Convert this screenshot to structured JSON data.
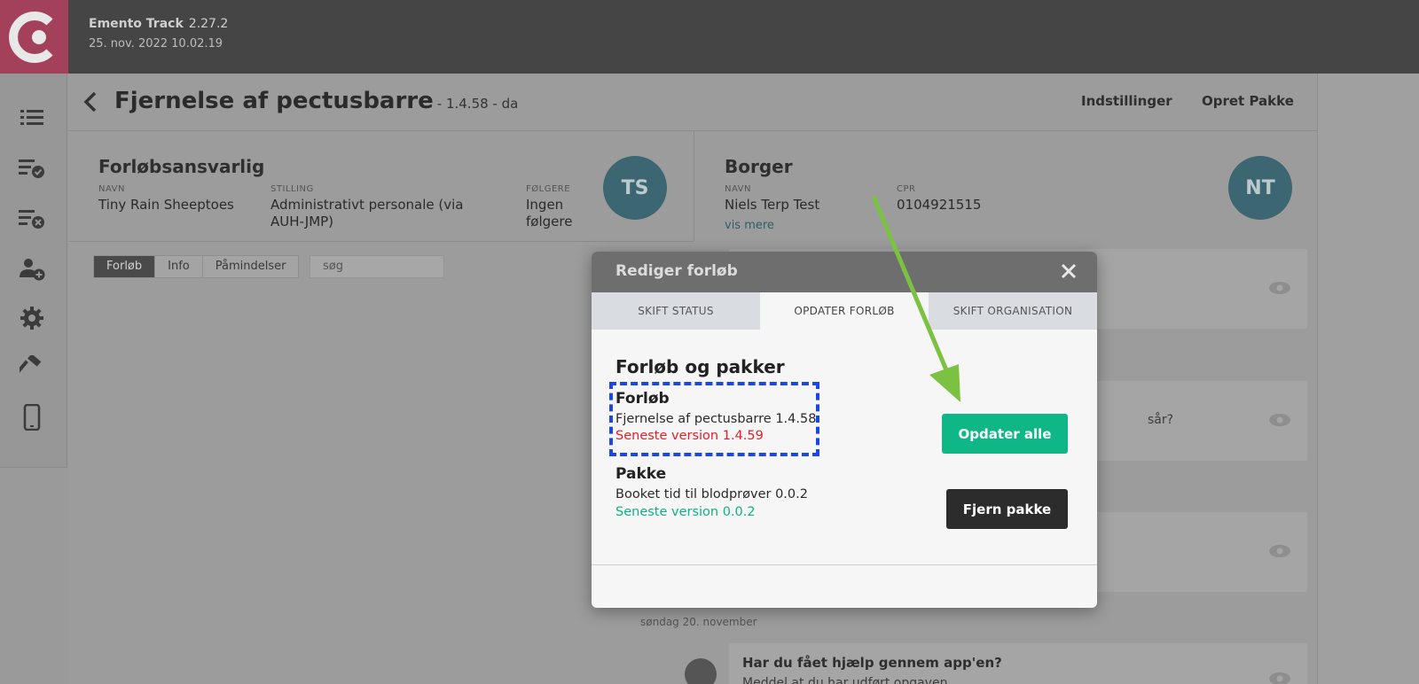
{
  "app": {
    "name": "Emento Track",
    "version": "2.27.2",
    "datetime": "25. nov. 2022 10.02.19"
  },
  "sidebar": {
    "items": [
      {
        "icon": "list-icon"
      },
      {
        "icon": "list-check-icon"
      },
      {
        "icon": "list-remove-icon"
      },
      {
        "icon": "add-user-icon"
      },
      {
        "icon": "gear-icon"
      },
      {
        "icon": "hammer-icon"
      },
      {
        "icon": "phone-icon"
      }
    ]
  },
  "header": {
    "title": "Fjernelse af pectusbarre",
    "subtitle": "- 1.4.58 - da",
    "links": [
      "Indstillinger",
      "Opret Pakke"
    ]
  },
  "responsible": {
    "title": "Forløbsansvarlig",
    "name_label": "NAVN",
    "name": "Tiny Rain Sheeptoes",
    "position_label": "STILLING",
    "position": "Administrativt personale (via AUH-JMP)",
    "followers_label": "FØLGERE",
    "followers": "Ingen følgere",
    "avatar": "TS"
  },
  "citizen": {
    "title": "Borger",
    "name_label": "NAVN",
    "name": "Niels Terp Test",
    "more_link": "vis mere",
    "cpr_label": "CPR",
    "cpr": "0104921515",
    "avatar": "NT"
  },
  "tabs_left": [
    "Forløb",
    "Info",
    "Påmindelser"
  ],
  "search": {
    "placeholder": "søg"
  },
  "timeline": {
    "partial_text": "sår?",
    "date_separator": "søndag 20. november",
    "card_title": "Har du fået hjælp gennem app'en?",
    "card_text": "Meddel at du har udført opgaven"
  },
  "modal": {
    "title": "Rediger forløb",
    "tabs": [
      "SKIFT STATUS",
      "OPDATER FORLØB",
      "SKIFT ORGANISATION"
    ],
    "section_title": "Forløb og pakker",
    "course": {
      "heading": "Forløb",
      "current": "Fjernelse af pectusbarre 1.4.58",
      "latest": "Seneste version 1.4.59"
    },
    "package": {
      "heading": "Pakke",
      "current": "Booket tid til blodprøver 0.0.2",
      "latest": "Seneste version 0.0.2"
    },
    "update_all": "Opdater alle",
    "remove_package": "Fjern pakke"
  },
  "colors": {
    "accent_green": "#10b786",
    "warning_red": "#e4202a",
    "highlight_blue": "#1e46e6",
    "arrow_green": "#7cc242"
  }
}
